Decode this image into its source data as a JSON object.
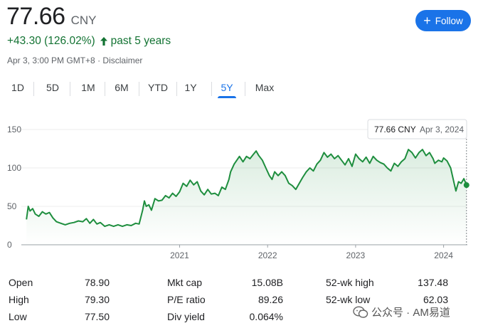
{
  "header": {
    "price": "77.66",
    "currency": "CNY",
    "change": "+43.30 (126.02%)",
    "period": "past 5 years",
    "timestamp": "Apr 3, 3:00 PM GMT+8",
    "separator": "·",
    "disclaimer": "Disclaimer",
    "follow_label": "Follow",
    "follow_icon": "plus-icon",
    "change_icon": "arrow-up-icon",
    "positive_color": "#137333",
    "accent_color": "#1a73e8"
  },
  "tabs": [
    {
      "label": "1D",
      "active": false
    },
    {
      "label": "5D",
      "active": false
    },
    {
      "label": "1M",
      "active": false
    },
    {
      "label": "6M",
      "active": false
    },
    {
      "label": "YTD",
      "active": false
    },
    {
      "label": "1Y",
      "active": false
    },
    {
      "label": "5Y",
      "active": true
    },
    {
      "label": "Max",
      "active": false
    }
  ],
  "chart_data": {
    "type": "area",
    "title": "",
    "xlabel": "",
    "ylabel": "",
    "ylim": [
      0,
      150
    ],
    "yticks": [
      0,
      50,
      100,
      150
    ],
    "xticks": [
      {
        "x": 2021.0,
        "label": "2021"
      },
      {
        "x": 2022.0,
        "label": "2022"
      },
      {
        "x": 2023.0,
        "label": "2023"
      },
      {
        "x": 2024.0,
        "label": "2024"
      }
    ],
    "xlim": [
      2019.25,
      2024.27
    ],
    "grid": true,
    "line_color": "#1e8e3e",
    "tooltip": {
      "value": "77.66 CNY",
      "date": "Apr 3, 2024"
    },
    "series": [
      {
        "points": [
          [
            2019.26,
            33
          ],
          [
            2019.28,
            50
          ],
          [
            2019.3,
            44
          ],
          [
            2019.33,
            47
          ],
          [
            2019.36,
            40
          ],
          [
            2019.4,
            37
          ],
          [
            2019.44,
            43
          ],
          [
            2019.48,
            40
          ],
          [
            2019.52,
            42
          ],
          [
            2019.56,
            35
          ],
          [
            2019.6,
            30
          ],
          [
            2019.65,
            28
          ],
          [
            2019.7,
            26
          ],
          [
            2019.75,
            28
          ],
          [
            2019.8,
            29
          ],
          [
            2019.85,
            31
          ],
          [
            2019.9,
            30
          ],
          [
            2019.94,
            34
          ],
          [
            2019.98,
            28
          ],
          [
            2020.02,
            33
          ],
          [
            2020.06,
            27
          ],
          [
            2020.1,
            29
          ],
          [
            2020.15,
            24
          ],
          [
            2020.2,
            26
          ],
          [
            2020.25,
            24
          ],
          [
            2020.3,
            26
          ],
          [
            2020.35,
            24
          ],
          [
            2020.4,
            26
          ],
          [
            2020.45,
            25
          ],
          [
            2020.5,
            28
          ],
          [
            2020.54,
            27
          ],
          [
            2020.58,
            45
          ],
          [
            2020.6,
            57
          ],
          [
            2020.62,
            50
          ],
          [
            2020.65,
            52
          ],
          [
            2020.68,
            45
          ],
          [
            2020.72,
            60
          ],
          [
            2020.76,
            57
          ],
          [
            2020.8,
            58
          ],
          [
            2020.84,
            64
          ],
          [
            2020.88,
            61
          ],
          [
            2020.92,
            67
          ],
          [
            2020.96,
            63
          ],
          [
            2021.0,
            69
          ],
          [
            2021.04,
            80
          ],
          [
            2021.08,
            76
          ],
          [
            2021.12,
            84
          ],
          [
            2021.16,
            78
          ],
          [
            2021.2,
            82
          ],
          [
            2021.24,
            70
          ],
          [
            2021.28,
            65
          ],
          [
            2021.32,
            72
          ],
          [
            2021.36,
            66
          ],
          [
            2021.4,
            67
          ],
          [
            2021.44,
            64
          ],
          [
            2021.48,
            75
          ],
          [
            2021.52,
            72
          ],
          [
            2021.56,
            85
          ],
          [
            2021.58,
            95
          ],
          [
            2021.62,
            105
          ],
          [
            2021.65,
            110
          ],
          [
            2021.68,
            115
          ],
          [
            2021.72,
            108
          ],
          [
            2021.76,
            115
          ],
          [
            2021.8,
            112
          ],
          [
            2021.84,
            118
          ],
          [
            2021.87,
            122
          ],
          [
            2021.9,
            116
          ],
          [
            2021.94,
            110
          ],
          [
            2021.98,
            100
          ],
          [
            2022.02,
            90
          ],
          [
            2022.05,
            85
          ],
          [
            2022.08,
            95
          ],
          [
            2022.12,
            90
          ],
          [
            2022.16,
            95
          ],
          [
            2022.2,
            90
          ],
          [
            2022.24,
            80
          ],
          [
            2022.28,
            77
          ],
          [
            2022.32,
            72
          ],
          [
            2022.36,
            80
          ],
          [
            2022.4,
            88
          ],
          [
            2022.44,
            95
          ],
          [
            2022.48,
            100
          ],
          [
            2022.52,
            96
          ],
          [
            2022.56,
            105
          ],
          [
            2022.6,
            110
          ],
          [
            2022.64,
            120
          ],
          [
            2022.68,
            114
          ],
          [
            2022.72,
            118
          ],
          [
            2022.76,
            112
          ],
          [
            2022.8,
            116
          ],
          [
            2022.84,
            110
          ],
          [
            2022.88,
            104
          ],
          [
            2022.92,
            112
          ],
          [
            2022.96,
            102
          ],
          [
            2023.0,
            118
          ],
          [
            2023.04,
            112
          ],
          [
            2023.08,
            108
          ],
          [
            2023.12,
            114
          ],
          [
            2023.16,
            106
          ],
          [
            2023.2,
            115
          ],
          [
            2023.24,
            110
          ],
          [
            2023.28,
            107
          ],
          [
            2023.32,
            105
          ],
          [
            2023.36,
            100
          ],
          [
            2023.4,
            96
          ],
          [
            2023.44,
            106
          ],
          [
            2023.48,
            102
          ],
          [
            2023.52,
            108
          ],
          [
            2023.56,
            112
          ],
          [
            2023.6,
            124
          ],
          [
            2023.64,
            120
          ],
          [
            2023.68,
            113
          ],
          [
            2023.72,
            120
          ],
          [
            2023.76,
            124
          ],
          [
            2023.8,
            116
          ],
          [
            2023.84,
            120
          ],
          [
            2023.88,
            112
          ],
          [
            2023.9,
            106
          ],
          [
            2023.94,
            110
          ],
          [
            2023.98,
            108
          ],
          [
            2024.0,
            113
          ],
          [
            2024.04,
            109
          ],
          [
            2024.08,
            100
          ],
          [
            2024.12,
            80
          ],
          [
            2024.14,
            70
          ],
          [
            2024.17,
            82
          ],
          [
            2024.2,
            80
          ],
          [
            2024.23,
            86
          ],
          [
            2024.26,
            77.66
          ]
        ]
      }
    ]
  },
  "stats": [
    [
      {
        "label": "Open",
        "value": "78.90"
      },
      {
        "label": "High",
        "value": "79.30"
      },
      {
        "label": "Low",
        "value": "77.50"
      }
    ],
    [
      {
        "label": "Mkt cap",
        "value": "15.08B"
      },
      {
        "label": "P/E ratio",
        "value": "89.26"
      },
      {
        "label": "Div yield",
        "value": "0.064%"
      }
    ],
    [
      {
        "label": "52-wk high",
        "value": "137.48"
      },
      {
        "label": "52-wk low",
        "value": "62.03"
      }
    ]
  ],
  "watermark": {
    "text": "公众号 · AM易道",
    "icon": "wechat-icon"
  }
}
